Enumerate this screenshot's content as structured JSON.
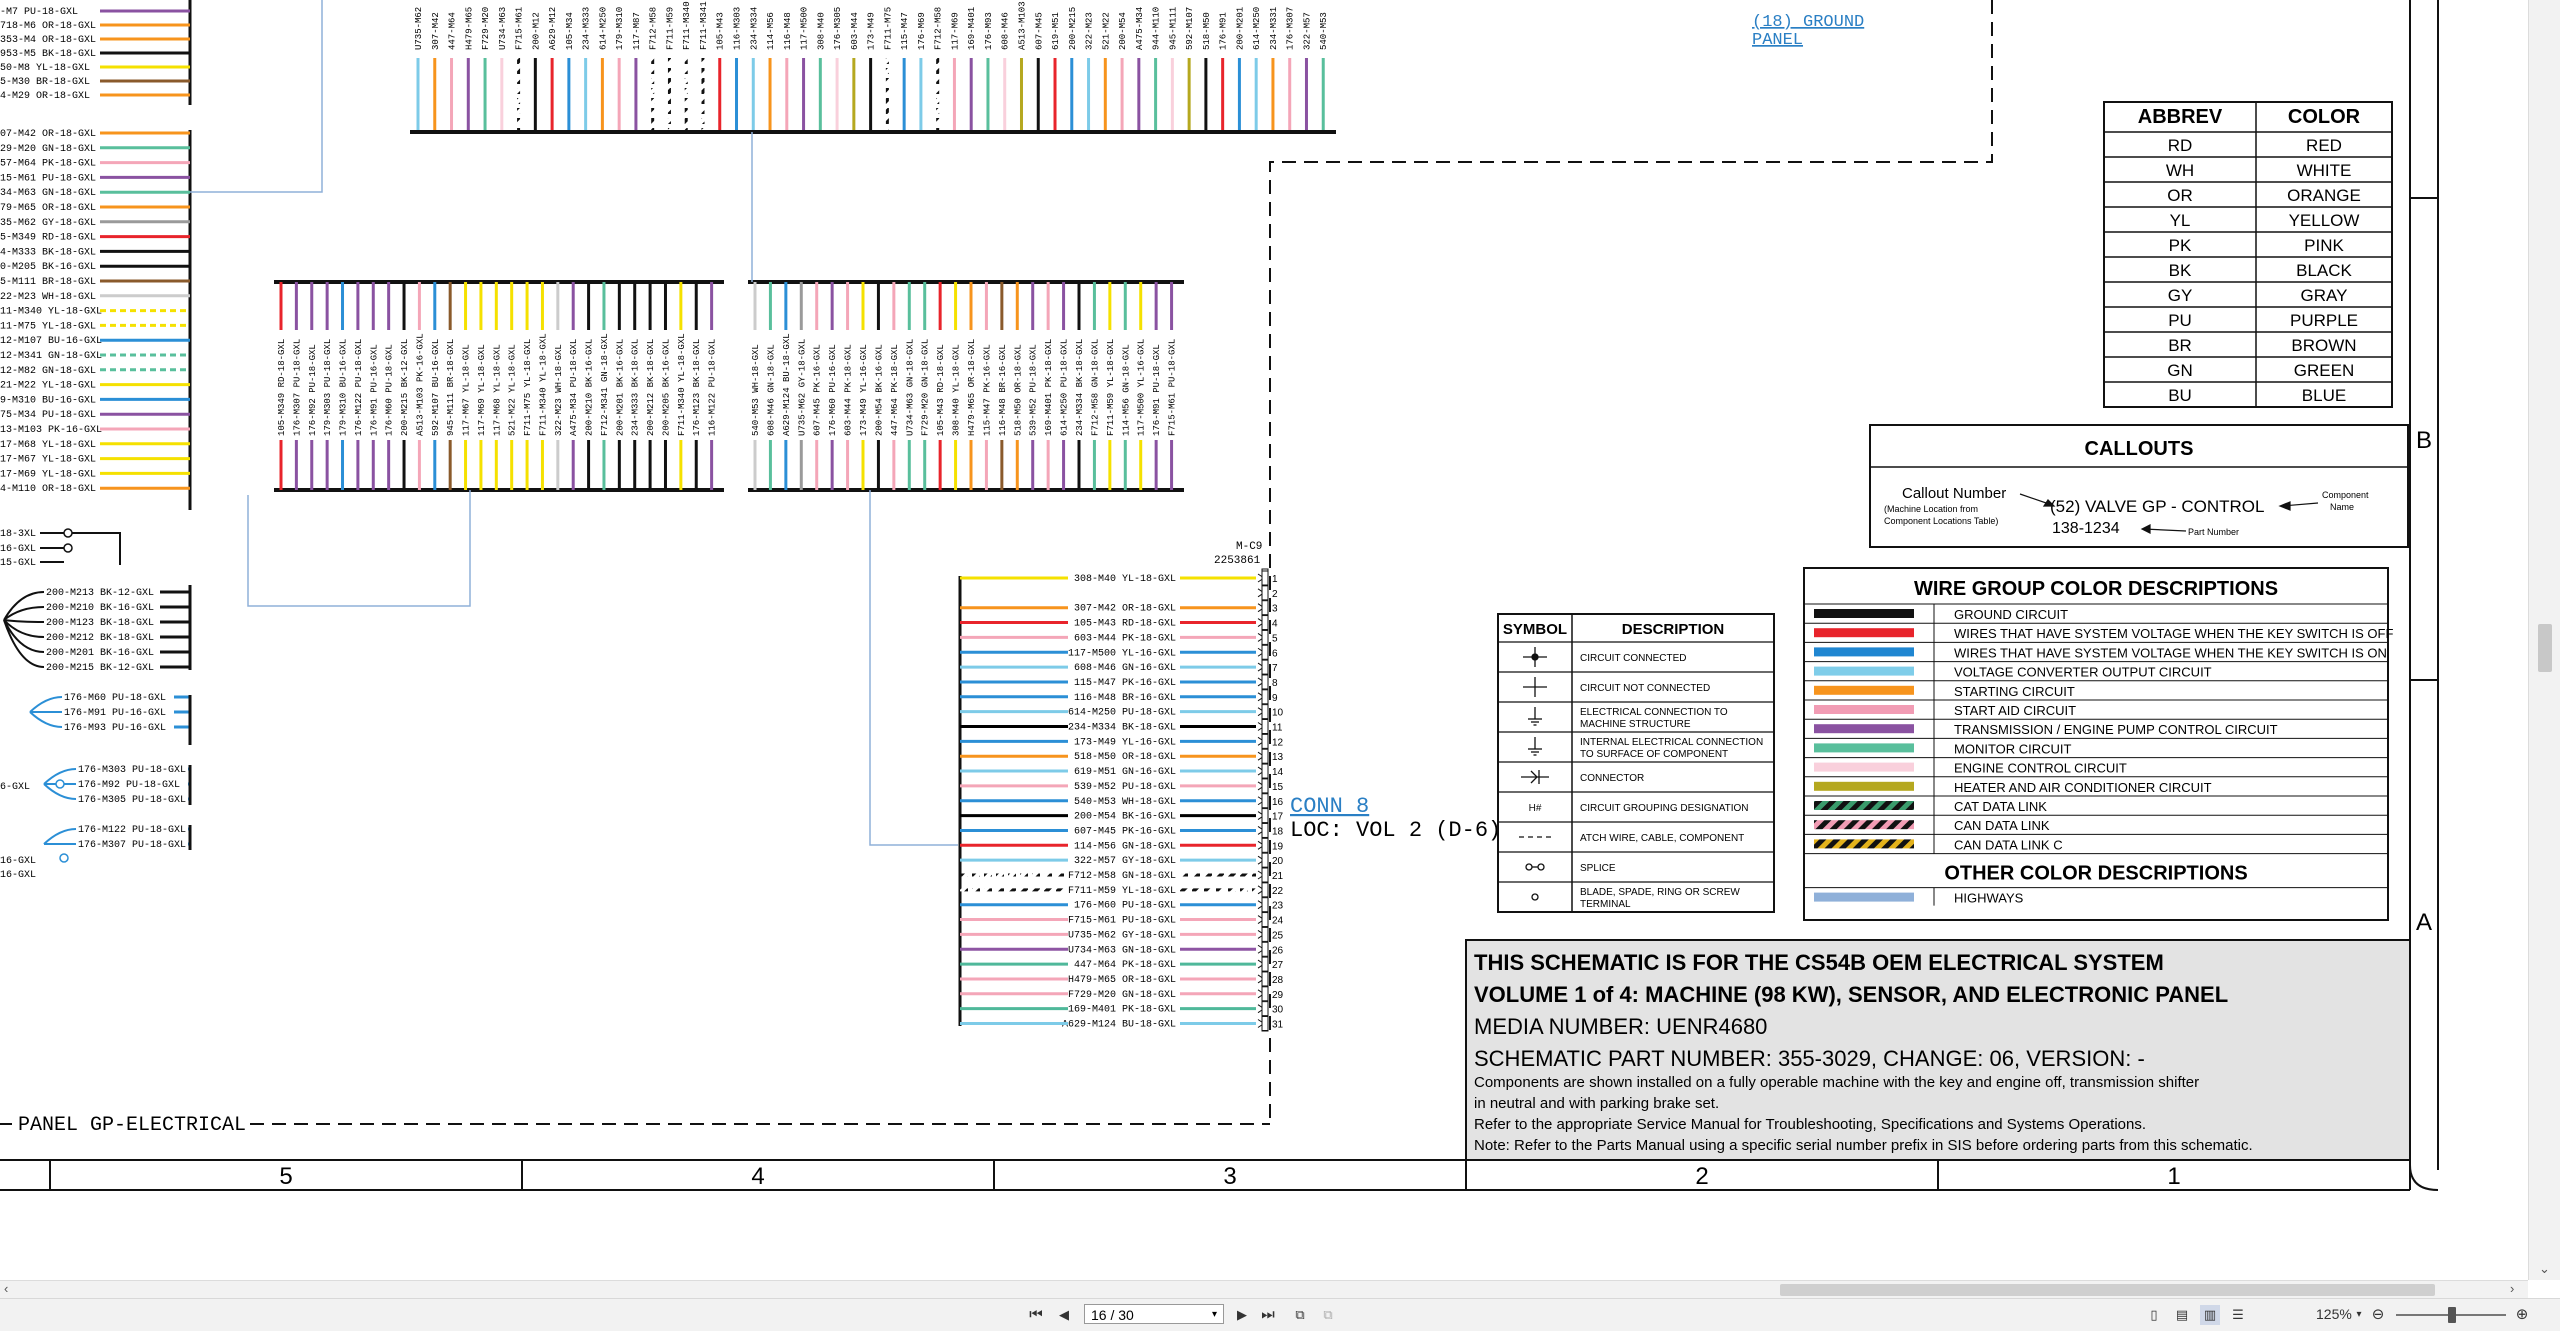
{
  "top_left_labels": [
    "-M7 PU-18-GXL",
    "718-M6 OR-18-GXL",
    "353-M4 OR-18-GXL",
    "953-M5 BK-18-GXL",
    "50-M8 YL-18-GXL",
    "5-M30 BR-18-GXL",
    "4-M29 OR-18-GXL"
  ],
  "mid_left_labels": [
    "07-M42 OR-18-GXL",
    "29-M20 GN-18-GXL",
    "57-M64 PK-18-GXL",
    "15-M61 PU-18-GXL",
    "34-M63 GN-18-GXL",
    "79-M65 OR-18-GXL",
    "35-M62 GY-18-GXL",
    "5-M349 RD-18-GXL",
    "4-M333 BK-18-GXL",
    "0-M205 BK-16-GXL",
    "5-M111 BR-18-GXL",
    "22-M23 WH-18-GXL",
    "11-M340 YL-18-GXL",
    "11-M75 YL-18-GXL",
    "12-M107 BU-16-GXL",
    "12-M341 GN-18-GXL",
    "12-M82 GN-18-GXL",
    "21-M22 YL-18-GXL",
    "9-M310 BU-16-GXL",
    "75-M34 PU-18-GXL",
    "13-M103 PK-16-GXL",
    "17-M68 YL-18-GXL",
    "17-M67 YL-18-GXL",
    "17-M69 YL-18-GXL",
    "4-M110 OR-18-GXL"
  ],
  "splice_left_labels": [
    "18-3XL",
    "16-GXL",
    "15-GXL"
  ],
  "ground_left_labels": [
    "200-M213 BK-12-GXL",
    "200-M210 BK-16-GXL",
    "200-M123 BK-18-GXL",
    "200-M212 BK-18-GXL",
    "200-M201 BK-16-GXL",
    "200-M215 BK-12-GXL"
  ],
  "blue_group_a": [
    "176-M60 PU-18-GXL",
    "176-M91 PU-16-GXL",
    "176-M93 PU-16-GXL"
  ],
  "blue_group_b": [
    "176-M303 PU-18-GXL",
    "176-M92 PU-18-GXL",
    "176-M305 PU-18-GXL"
  ],
  "blue_group_b_left": "6-GXL",
  "blue_group_c": [
    "176-M122 PU-18-GXL",
    "176-M307 PU-18-GXL"
  ],
  "blue_group_c_left": [
    "16-GXL",
    "16-GXL"
  ],
  "top_vertical_labels": [
    "U735-M62",
    "307-M42",
    "447-M64",
    "H479-M65",
    "F729-M20",
    "U734-M63",
    "F715-M61",
    "200-M12",
    "A629-M12",
    "105-M34",
    "234-M333",
    "614-M250",
    "179-M310",
    "117-M87",
    "F712-M58",
    "F711-M59",
    "F711-M340",
    "F711-M341",
    "105-M43",
    "116-M303",
    "234-M334",
    "114-M56",
    "116-M48",
    "117-M500",
    "308-M40",
    "176-M305",
    "603-M44",
    "173-M49",
    "F711-M75",
    "115-M47",
    "176-M69",
    "F712-M58",
    "117-M69",
    "169-M401",
    "176-M93",
    "608-M46",
    "A513-M103",
    "607-M45",
    "619-M51",
    "200-M215",
    "322-M23",
    "521-M22",
    "200-M54",
    "A475-M34",
    "944-M110",
    "945-M111",
    "592-M107",
    "518-M50",
    "176-M91",
    "200-M201",
    "614-M250",
    "234-M331",
    "176-M307",
    "322-M57",
    "540-M53"
  ],
  "row2_vertical_labels_a": [
    "105-M349 RD-18-GXL",
    "176-M307 PU-18-GXL",
    "176-M92 PU-18-GXL",
    "179-M303 PU-18-GXL",
    "179-M310 BU-16-GXL",
    "176-M122 PU-18-GXL",
    "176-M91 PU-16-GXL",
    "176-M60 PU-18-GXL",
    "200-M215 BK-12-GXL",
    "A513-M103 PK-16-GXL",
    "592-M107 BU-16-GXL",
    "945-M111 BR-18-GXL",
    "117-M67 YL-18-GXL",
    "117-M69 YL-18-GXL",
    "117-M68 YL-18-GXL",
    "521-M22 YL-18-GXL",
    "F711-M75 YL-18-GXL",
    "F711-M340 YL-18-GXL",
    "322-M23 WH-18-GXL",
    "A475-M34 PU-18-GXL",
    "200-M210 BK-16-GXL",
    "F712-M341 GN-18-GXL",
    "200-M201 BK-16-GXL",
    "234-M333 BK-18-GXL",
    "200-M212 BK-18-GXL",
    "200-M205 BK-16-GXL",
    "F711-M340 YL-18-GXL",
    "176-M123 BK-18-GXL",
    "116-M122 PU-18-GXL"
  ],
  "row2_vertical_labels_b": [
    "540-M53 WH-18-GXL",
    "608-M46 GN-18-GXL",
    "A629-M124 BU-18-GXL",
    "U735-M62 GY-18-GXL",
    "607-M45 PK-16-GXL",
    "176-M60 PU-16-GXL",
    "603-M44 PK-18-GXL",
    "173-M49 YL-16-GXL",
    "200-M54 BK-16-GXL",
    "447-M64 PK-18-GXL",
    "U734-M63 GN-18-GXL",
    "F729-M20 GN-18-GXL",
    "105-M43 RD-18-GXL",
    "308-M40 YL-18-GXL",
    "H479-M65 OR-18-GXL",
    "115-M47 PK-16-GXL",
    "116-M48 BR-16-GXL",
    "518-M50 OR-18-GXL",
    "539-M52 PU-18-GXL",
    "169-M401 PK-18-GXL",
    "614-M250 PU-18-GXL",
    "234-M334 BK-18-GXL",
    "F712-M58 GN-18-GXL",
    "F711-M59 YL-18-GXL",
    "114-M56 GN-18-GXL",
    "117-M500 YL-16-GXL",
    "176-M91 PU-18-GXL",
    "F715-M61 PU-18-GXL"
  ],
  "connector": {
    "id": "M-C9",
    "part": "2253861",
    "title": "CONN 8",
    "loc": "LOC: VOL 2 (D-6)",
    "pins": [
      {
        "n": "1",
        "label": "308-M40 YL-18-GXL",
        "color": "#f5e100"
      },
      {
        "n": "2",
        "label": "",
        "color": ""
      },
      {
        "n": "3",
        "label": "307-M42 OR-18-GXL",
        "color": "#f7941d"
      },
      {
        "n": "4",
        "label": "105-M43 RD-18-GXL",
        "color": "#e8242b"
      },
      {
        "n": "5",
        "label": "603-M44 PK-18-GXL",
        "color": "#f4a6b8"
      },
      {
        "n": "6",
        "label": "117-M500 YL-16-GXL",
        "color": "#2b8fd6"
      },
      {
        "n": "7",
        "label": "608-M46 GN-16-GXL",
        "color": "#7dcbe8"
      },
      {
        "n": "8",
        "label": "115-M47 PK-16-GXL",
        "color": "#2b8fd6"
      },
      {
        "n": "9",
        "label": "116-M48 BR-16-GXL",
        "color": "#2b8fd6"
      },
      {
        "n": "10",
        "label": "614-M250 PU-18-GXL",
        "color": "#7dcbe8"
      },
      {
        "n": "11",
        "label": "234-M334 BK-18-GXL",
        "color": "#000000"
      },
      {
        "n": "12",
        "label": "173-M49 YL-16-GXL",
        "color": "#2b8fd6"
      },
      {
        "n": "13",
        "label": "518-M50 OR-18-GXL",
        "color": "#f7941d"
      },
      {
        "n": "14",
        "label": "619-M51 GN-16-GXL",
        "color": "#7dcbe8"
      },
      {
        "n": "15",
        "label": "539-M52 PU-18-GXL",
        "color": "#f4a6b8"
      },
      {
        "n": "16",
        "label": "540-M53 WH-18-GXL",
        "color": "#2b8fd6"
      },
      {
        "n": "17",
        "label": "200-M54 BK-16-GXL",
        "color": "#000000"
      },
      {
        "n": "18",
        "label": "607-M45 PK-16-GXL",
        "color": "#2b8fd6"
      },
      {
        "n": "19",
        "label": "114-M56 GN-18-GXL",
        "color": "#e8242b"
      },
      {
        "n": "20",
        "label": "322-M57 GY-18-GXL",
        "color": "#7dcbe8"
      },
      {
        "n": "21",
        "label": "F712-M58 GN-18-GXL",
        "color": "cdl"
      },
      {
        "n": "22",
        "label": "F711-M59 YL-18-GXL",
        "color": "cdl"
      },
      {
        "n": "23",
        "label": "176-M60 PU-18-GXL",
        "color": "#2b8fd6"
      },
      {
        "n": "24",
        "label": "F715-M61 PU-18-GXL",
        "color": "#f4a6b8"
      },
      {
        "n": "25",
        "label": "U735-M62 GY-18-GXL",
        "color": "#f4a6b8"
      },
      {
        "n": "26",
        "label": "U734-M63 GN-18-GXL",
        "color": "#8e55a3"
      },
      {
        "n": "27",
        "label": "447-M64 PK-18-GXL",
        "color": "#4fb89a"
      },
      {
        "n": "28",
        "label": "H479-M65 OR-18-GXL",
        "color": "#f4a6b8"
      },
      {
        "n": "29",
        "label": "F729-M20 GN-18-GXL",
        "color": "#f4a6b8"
      },
      {
        "n": "30",
        "label": "169-M401 PK-18-GXL",
        "color": "#4fb89a"
      },
      {
        "n": "31",
        "label": "A629-M124 BU-18-GXL",
        "color": "#7dcbe8"
      }
    ]
  },
  "ground_panel": {
    "line1": "(18) GROUND",
    "line2": "PANEL"
  },
  "panel_label": "PANEL GP-ELECTRICAL",
  "abbrev_table": {
    "headers": [
      "ABBREV",
      "COLOR"
    ],
    "rows": [
      [
        "RD",
        "RED"
      ],
      [
        "WH",
        "WHITE"
      ],
      [
        "OR",
        "ORANGE"
      ],
      [
        "YL",
        "YELLOW"
      ],
      [
        "PK",
        "PINK"
      ],
      [
        "BK",
        "BLACK"
      ],
      [
        "GY",
        "GRAY"
      ],
      [
        "PU",
        "PURPLE"
      ],
      [
        "BR",
        "BROWN"
      ],
      [
        "GN",
        "GREEN"
      ],
      [
        "BU",
        "BLUE"
      ]
    ]
  },
  "callouts": {
    "title": "CALLOUTS",
    "callout_number": "Callout Number",
    "machine_location_1": "(Machine Location from",
    "machine_location_2": "Component Locations Table)",
    "main": "(52) VALVE GP - CONTROL",
    "part": "138-1234",
    "part_number_label": "Part Number",
    "component_1": "Component",
    "component_2": "Name"
  },
  "wire_group": {
    "title": "WIRE GROUP COLOR DESCRIPTIONS",
    "rows": [
      {
        "color": "#111111",
        "label": "GROUND CIRCUIT"
      },
      {
        "color": "#e8242b",
        "label": "WIRES THAT HAVE SYSTEM VOLTAGE WHEN THE KEY SWITCH IS OFF"
      },
      {
        "color": "#1f86d1",
        "label": "WIRES THAT HAVE SYSTEM VOLTAGE WHEN THE KEY SWITCH IS ON"
      },
      {
        "color": "#7fcde9",
        "label": "VOLTAGE CONVERTER OUTPUT CIRCUIT"
      },
      {
        "color": "#f7941d",
        "label": "STARTING CIRCUIT"
      },
      {
        "color": "#f19cb4",
        "label": "START AID CIRCUIT"
      },
      {
        "color": "#8a52a1",
        "label": "TRANSMISSION / ENGINE PUMP CONTROL CIRCUIT"
      },
      {
        "color": "#59bf9c",
        "label": "MONITOR CIRCUIT"
      },
      {
        "color": "#f9d0dc",
        "label": "ENGINE CONTROL CIRCUIT"
      },
      {
        "color": "#b5a81f",
        "label": "HEATER AND AIR CONDITIONER CIRCUIT"
      },
      {
        "color": "cat",
        "label": "CAT DATA LINK"
      },
      {
        "color": "can",
        "label": "CAN DATA LINK"
      },
      {
        "color": "canc",
        "label": "CAN DATA LINK C"
      }
    ],
    "other_title": "OTHER COLOR DESCRIPTIONS",
    "other_rows": [
      {
        "color": "#8fb0d9",
        "label": "HIGHWAYS"
      }
    ]
  },
  "symbol_table": {
    "headers": [
      "SYMBOL",
      "DESCRIPTION"
    ],
    "rows": [
      {
        "icon": "circuit-connected",
        "label": "CIRCUIT CONNECTED"
      },
      {
        "icon": "circuit-not-connected",
        "label": "CIRCUIT NOT CONNECTED"
      },
      {
        "icon": "ground-structure",
        "label": "ELECTRICAL CONNECTION TO MACHINE STRUCTURE"
      },
      {
        "icon": "ground-component",
        "label": "INTERNAL ELECTRICAL CONNECTION TO SURFACE OF COMPONENT"
      },
      {
        "icon": "connector",
        "label": "CONNECTOR"
      },
      {
        "icon": "group",
        "label": "CIRCUIT GROUPING DESIGNATION"
      },
      {
        "icon": "attach",
        "label": "ATCH WIRE, CABLE, COMPONENT"
      },
      {
        "icon": "splice",
        "label": "SPLICE"
      },
      {
        "icon": "terminal",
        "label": "BLADE, SPADE, RING OR SCREW TERMINAL"
      }
    ],
    "group_symbol": "H#"
  },
  "title_block": {
    "line1": "THIS SCHEMATIC IS FOR THE CS54B OEM ELECTRICAL SYSTEM",
    "line2": "VOLUME 1 of 4: MACHINE (98 KW), SENSOR, AND ELECTRONIC PANEL",
    "line3": "MEDIA NUMBER: UENR4680",
    "line4": "SCHEMATIC PART NUMBER: 355-3029, CHANGE: 06, VERSION: -",
    "note1": "Components are shown installed on a fully operable machine with the key and engine off, transmission shifter",
    "note2": "in neutral and with parking brake set.",
    "note3": "Refer to the appropriate Service Manual for Troubleshooting, Specifications and Systems Operations.",
    "note4": "Note: Refer to the Parts Manual using a specific serial number prefix in SIS before ordering parts from this schematic."
  },
  "zones": [
    "5",
    "4",
    "3",
    "2",
    "1"
  ],
  "row_labels": [
    "B",
    "A"
  ],
  "toolbar": {
    "page": "16 / 30",
    "zoom": "125%",
    "first": "⏮",
    "prev": "◀",
    "next": "▶",
    "last": "⏭"
  }
}
